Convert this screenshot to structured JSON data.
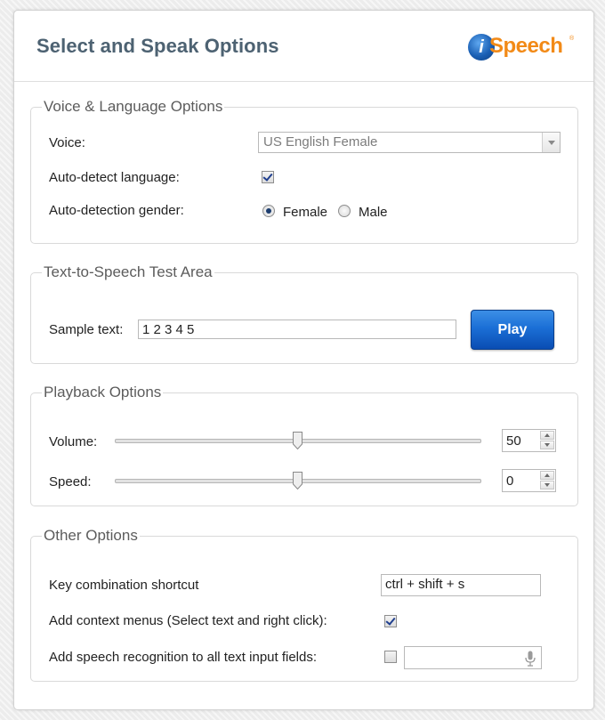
{
  "header": {
    "title": "Select and Speak Options",
    "logo": {
      "mark": "i",
      "text": "Speech",
      "tm": "®",
      "color": "#f28a17"
    }
  },
  "voice_language": {
    "legend": "Voice & Language Options",
    "voice_label": "Voice:",
    "voice_value": "US English Female",
    "autodetect_label": "Auto-detect language:",
    "autodetect_checked": true,
    "gender_label": "Auto-detection gender:",
    "gender_options": [
      "Female",
      "Male"
    ],
    "gender_selected": "Female"
  },
  "tts_test": {
    "legend": "Text-to-Speech Test Area",
    "sample_label": "Sample text:",
    "sample_value": "1 2 3 4 5",
    "play_label": "Play"
  },
  "playback": {
    "legend": "Playback Options",
    "volume_label": "Volume:",
    "volume_value": "50",
    "volume_fraction": 0.5,
    "speed_label": "Speed:",
    "speed_value": "0",
    "speed_fraction": 0.5
  },
  "other": {
    "legend": "Other Options",
    "shortcut_label": "Key combination shortcut",
    "shortcut_value": "ctrl + shift + s",
    "context_label": "Add context menus (Select text and right click):",
    "context_checked": true,
    "speech_recog_label": "Add speech recognition to all text input fields:",
    "speech_recog_checked": false,
    "speech_recog_icon": "microphone-icon"
  },
  "colors": {
    "title": "#4d6272",
    "accent_button": "#1b6fd6",
    "logo_orange": "#f28a17"
  }
}
